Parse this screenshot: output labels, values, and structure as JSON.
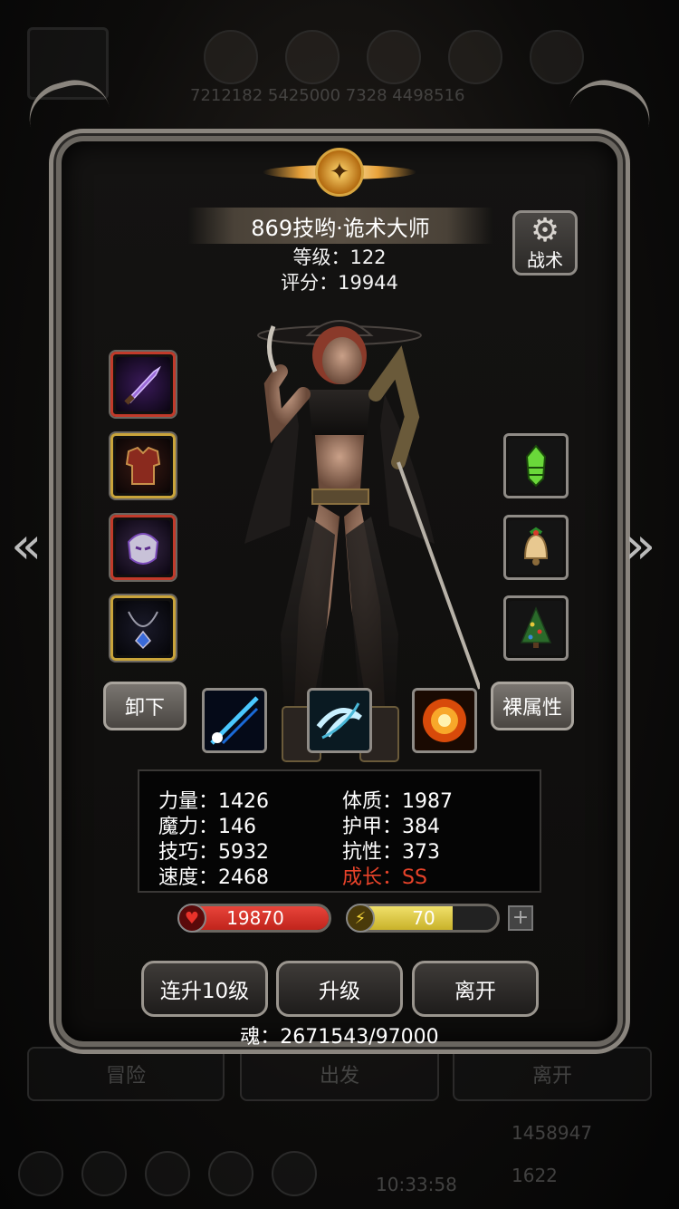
{
  "background_hud": {
    "numbers": "7212182  5425000  7328  4498516",
    "tabs": [
      "冒险",
      "出发",
      "离开"
    ],
    "time": "10:33:58",
    "gold": "1458947",
    "gems": "1622"
  },
  "character": {
    "name": "869技哟·诡术大师",
    "level_text": "等级：122",
    "score_text": "评分：19944"
  },
  "tactic_button": {
    "label": "战术",
    "icon": "gear-icon"
  },
  "equipment_left": [
    {
      "name": "dagger",
      "frame": "red"
    },
    {
      "name": "armor",
      "frame": "gold"
    },
    {
      "name": "helmet",
      "frame": "red"
    },
    {
      "name": "necklace",
      "frame": "gold"
    }
  ],
  "equipment_right": [
    {
      "name": "green-gem",
      "frame": "grey"
    },
    {
      "name": "bell",
      "frame": "grey"
    },
    {
      "name": "christmas-tree",
      "frame": "grey"
    }
  ],
  "buttons": {
    "unequip": "卸下",
    "base_attributes": "裸属性",
    "multi_level_up": "连升10级",
    "level_up": "升级",
    "leave": "离开"
  },
  "skills": [
    "blue-beam-skill",
    "whirlwind-skill",
    "fire-burst-skill"
  ],
  "stats": {
    "strength": "力量：1426",
    "constitution": "体质：1987",
    "magic": "魔力：146",
    "armor": "护甲：384",
    "skill": "技巧：5932",
    "resistance": "抗性：373",
    "speed": "速度：2468",
    "growth": "成长：SS"
  },
  "hp": {
    "value": "19870",
    "fill": 1.0,
    "color": "#c0241c"
  },
  "energy": {
    "value": "70",
    "fill": 0.7,
    "color": "#c9b22a"
  },
  "soul_text": "魂：2671543/97000"
}
